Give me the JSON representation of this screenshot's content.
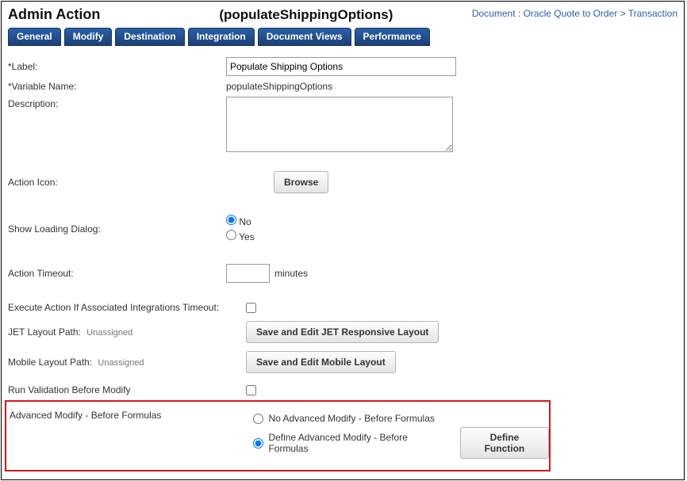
{
  "header": {
    "title": "Admin Action",
    "subtitle": "(populateShippingOptions)",
    "breadcrumb_prefix": "Document : ",
    "breadcrumb_link1": "Oracle Quote to Order",
    "breadcrumb_sep": " > ",
    "breadcrumb_link2": "Transaction"
  },
  "tabs": [
    "General",
    "Modify",
    "Destination",
    "Integration",
    "Document Views",
    "Performance"
  ],
  "form": {
    "label_lbl": "*Label:",
    "label_value": "Populate Shipping Options",
    "varname_lbl": "*Variable Name:",
    "varname_value": "populateShippingOptions",
    "desc_lbl": "Description:",
    "desc_value": "",
    "actionicon_lbl": "Action Icon:",
    "browse_btn": "Browse",
    "loading_lbl": "Show Loading Dialog:",
    "loading_no": "No",
    "loading_yes": "Yes",
    "timeout_lbl": "Action Timeout:",
    "timeout_value": "",
    "timeout_units": "minutes",
    "exec_ti_lbl": "Execute Action If Associated Integrations Timeout:",
    "jet_lbl": "JET Layout Path:",
    "jet_sub": "Unassigned",
    "jet_btn": "Save and Edit JET Responsive Layout",
    "mobile_lbl": "Mobile Layout Path:",
    "mobile_sub": "Unassigned",
    "mobile_btn": "Save and Edit Mobile Layout",
    "runval_lbl": "Run Validation Before Modify"
  },
  "advanced": {
    "section_lbl": "Advanced Modify - Before Formulas",
    "opt_none": "No Advanced Modify - Before Formulas",
    "opt_define": "Define Advanced Modify - Before Formulas",
    "define_btn": "Define Function"
  }
}
